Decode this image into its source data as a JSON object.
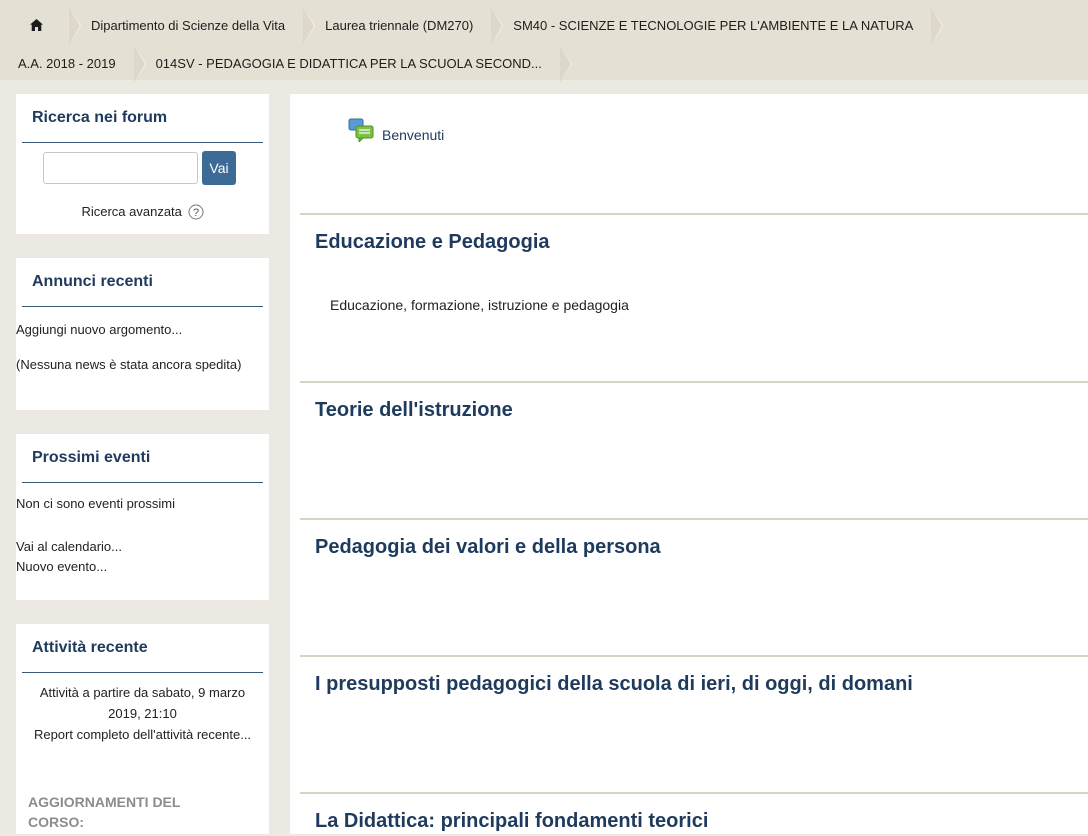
{
  "breadcrumb": {
    "row1": [
      {
        "label": ""
      },
      {
        "label": "Dipartimento di Scienze della Vita"
      },
      {
        "label": "Laurea triennale (DM270)"
      },
      {
        "label": "SM40 - SCIENZE E TECNOLOGIE PER L'AMBIENTE E LA NATURA"
      }
    ],
    "row2": [
      {
        "label": "A.A. 2018 - 2019"
      },
      {
        "label": "014SV - PEDAGOGIA E DIDATTICA PER LA SCUOLA SECOND..."
      }
    ]
  },
  "sidebar": {
    "search": {
      "title": "Ricerca nei forum",
      "input_value": "",
      "button_label": "Vai",
      "advanced_label": "Ricerca avanzata"
    },
    "news": {
      "title": "Annunci recenti",
      "add_link": "Aggiungi nuovo argomento...",
      "empty_text": "(Nessuna news è stata ancora spedita)"
    },
    "events": {
      "title": "Prossimi eventi",
      "empty_text": "Non ci sono eventi prossimi",
      "calendar_link": "Vai al calendario...",
      "new_event_link": "Nuovo evento..."
    },
    "activity": {
      "title": "Attività recente",
      "since_text": "Attività a partire da sabato, 9 marzo 2019, 21:10",
      "report_link": "Report completo dell'attività recente...",
      "updates_heading": "AGGIORNAMENTI DEL CORSO:"
    }
  },
  "main": {
    "forum_link": "Benvenuti",
    "sections": [
      {
        "title": "Educazione e Pedagogia",
        "summary": "Educazione, formazione, istruzione e pedagogia"
      },
      {
        "title": "Teorie dell'istruzione",
        "summary": ""
      },
      {
        "title": "Pedagogia dei valori e della persona",
        "summary": ""
      },
      {
        "title": "I presupposti pedagogici della scuola di ieri, di oggi, di domani",
        "summary": ""
      },
      {
        "title": "La Didattica: principali fondamenti teorici",
        "summary": ""
      }
    ]
  },
  "icons": {
    "home": "home-icon",
    "help": "help-icon",
    "forum": "forum-icon"
  },
  "colors": {
    "heading": "#1e3a5c",
    "button": "#3b6b96",
    "breadcrumb_bg": "#e5e0d4",
    "page_bg": "#ece9e2"
  }
}
